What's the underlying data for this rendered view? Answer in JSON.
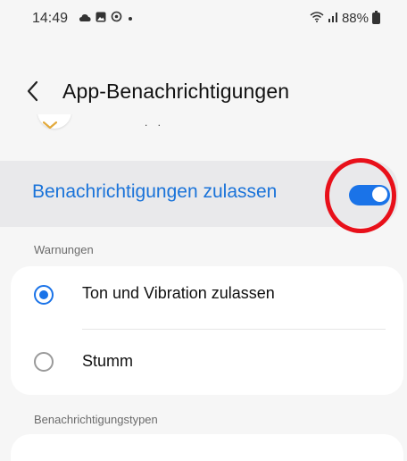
{
  "status_bar": {
    "time": "14:49",
    "left_icons": [
      "cloud-icon",
      "gallery-icon",
      "sync-icon",
      "dot-icon"
    ],
    "battery_percent": "88%",
    "right_icons": [
      "wifi-icon",
      "signal-icon",
      "battery-icon"
    ]
  },
  "header": {
    "title": "App-Benachrichtigungen",
    "back_icon": "chevron-left-icon"
  },
  "app_row": {
    "dots": ". ."
  },
  "allow": {
    "label": "Benachrichtigungen zulassen",
    "enabled": true,
    "accent_color": "#1a73e8"
  },
  "warnings": {
    "header": "Warnungen",
    "options": [
      {
        "label": "Ton und Vibration zulassen",
        "selected": true
      },
      {
        "label": "Stumm",
        "selected": false
      }
    ]
  },
  "notification_types": {
    "header": "Benachrichtigungstypen"
  },
  "annotation": {
    "color": "#e8101a",
    "target": "allow-toggle"
  }
}
